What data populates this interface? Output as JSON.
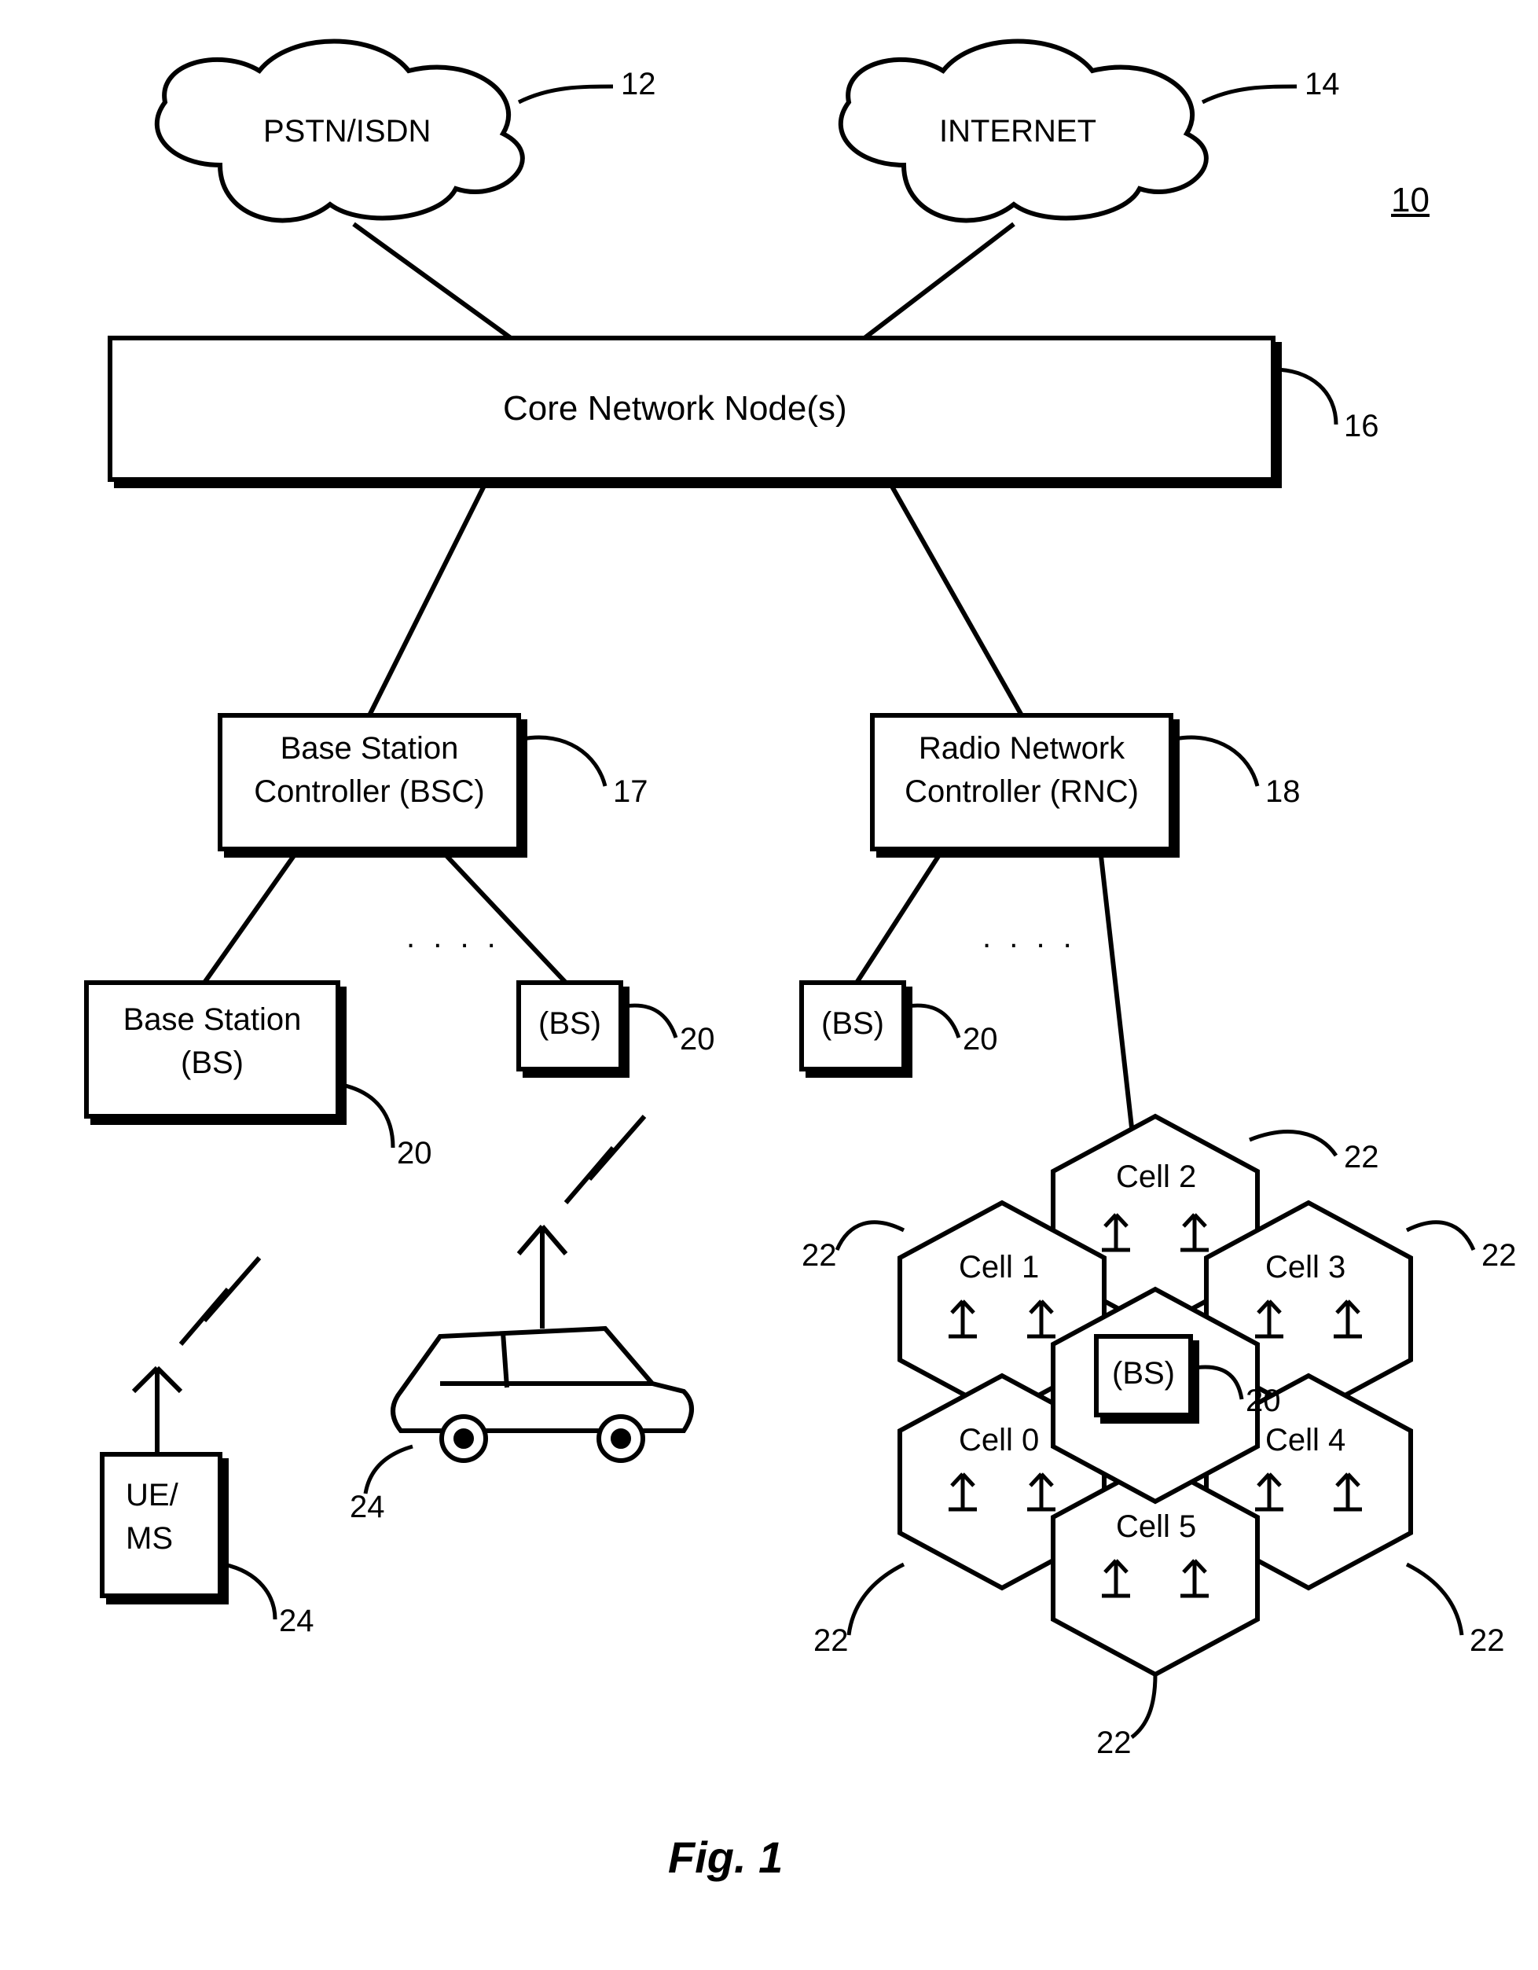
{
  "figure": {
    "ref_number": "10",
    "caption": "Fig. 1",
    "clouds": {
      "pstn": {
        "label": "PSTN/ISDN",
        "ref": "12"
      },
      "internet": {
        "label": "INTERNET",
        "ref": "14"
      }
    },
    "core": {
      "label": "Core Network Node(s)",
      "ref": "16"
    },
    "controllers": {
      "bsc": {
        "line1": "Base Station",
        "line2": "Controller (BSC)",
        "ref": "17"
      },
      "rnc": {
        "line1": "Radio Network",
        "line2": "Controller (RNC)",
        "ref": "18"
      }
    },
    "bs": {
      "big": {
        "line1": "Base Station",
        "line2": "(BS)",
        "ref": "20"
      },
      "small_label": "(BS)",
      "ref": "20"
    },
    "dots": ". . . .",
    "dots_right": ". . . .",
    "ue": {
      "line1": "UE/",
      "line2": "MS",
      "ref": "24"
    },
    "car_ref": "24",
    "cells": {
      "ref": "22",
      "c0": "Cell 0",
      "c1": "Cell 1",
      "c2": "Cell 2",
      "c3": "Cell 3",
      "c4": "Cell 4",
      "c5": "Cell 5"
    }
  }
}
